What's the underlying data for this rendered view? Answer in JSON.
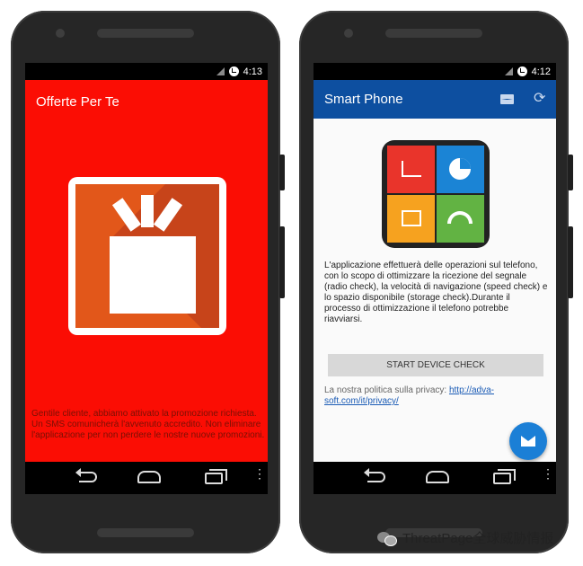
{
  "left_phone": {
    "status_time": "4:13",
    "app_title": "Offerte Per Te",
    "message": "Gentile cliente, abbiamo attivato la promozione richiesta. Un SMS comunicherà l'avvenuto accredito. Non eliminare l'applicazione per non perdere le nostre nuove promozioni.",
    "colors": {
      "background": "#fb0d04",
      "gift_tile": "#e2571a"
    },
    "icon": "gift-icon"
  },
  "right_phone": {
    "status_time": "4:12",
    "app_title": "Smart Phone",
    "toolbar_icons": [
      "mail-icon",
      "sync-icon"
    ],
    "description": "L'applicazione effettuerà delle operazioni sul telefono, con lo scopo di ottimizzare la ricezione del segnale (radio check), la velocità di navigazione (speed check) e lo spazio disponibile (storage check).Durante il processo di ottimizzazione il telefono potrebbe riavviarsi.",
    "start_button_label": "START DEVICE CHECK",
    "privacy_text": "La nostra politica sulla privacy:",
    "privacy_link": "http://adva-soft.com/it/privacy/",
    "colors": {
      "toolbar": "#0d4fa0",
      "fab": "#1b7fd6"
    }
  },
  "watermark": {
    "text": "ThreatPage全球威胁情报"
  }
}
